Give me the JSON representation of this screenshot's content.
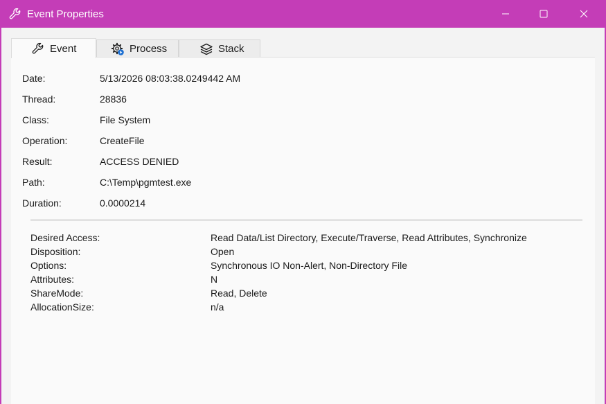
{
  "window": {
    "title": "Event Properties",
    "accent_color": "#c43db7",
    "title_icon": "wrench-icon",
    "controls": {
      "minimize_icon": "minimize-icon",
      "maximize_icon": "maximize-icon",
      "close_icon": "close-icon"
    }
  },
  "tabs": [
    {
      "label": "Event",
      "icon": "wrench-icon",
      "active": true
    },
    {
      "label": "Process",
      "icon": "gear-icon",
      "active": false
    },
    {
      "label": "Stack",
      "icon": "layers-icon",
      "active": false
    }
  ],
  "event": {
    "fields": [
      {
        "label": "Date:",
        "value": "5/13/2026 08:03:38.0249442 AM"
      },
      {
        "label": "Thread:",
        "value": "28836"
      },
      {
        "label": "Class:",
        "value": "File System"
      },
      {
        "label": "Operation:",
        "value": "CreateFile"
      },
      {
        "label": "Result:",
        "value": "ACCESS DENIED"
      },
      {
        "label": "Path:",
        "value": "C:\\Temp\\pgmtest.exe"
      },
      {
        "label": "Duration:",
        "value": "0.0000214"
      }
    ],
    "details": [
      {
        "label": "Desired Access:",
        "value": "Read Data/List Directory, Execute/Traverse, Read Attributes, Synchronize"
      },
      {
        "label": "Disposition:",
        "value": "Open"
      },
      {
        "label": "Options:",
        "value": "Synchronous IO Non-Alert, Non-Directory File"
      },
      {
        "label": "Attributes:",
        "value": "N"
      },
      {
        "label": "ShareMode:",
        "value": "Read, Delete"
      },
      {
        "label": "AllocationSize:",
        "value": "n/a"
      }
    ]
  }
}
